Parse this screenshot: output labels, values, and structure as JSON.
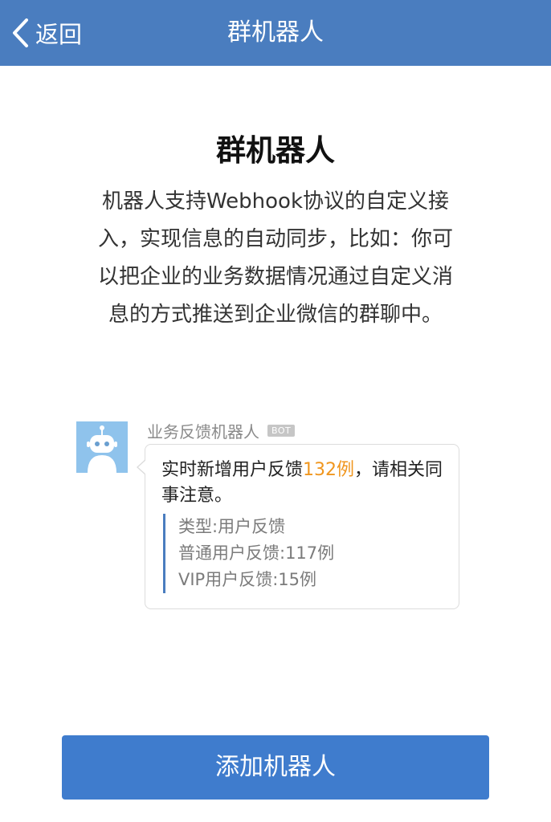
{
  "navbar": {
    "back_label": "返回",
    "title": "群机器人",
    "background": "#4a7dbf"
  },
  "intro": {
    "title": "群机器人",
    "description_lines": [
      "机器人支持Webhook协议的自定义接",
      "入，实现信息的自动同步，比如：你可",
      "以把企业的业务数据情况通过自定义消",
      "息的方式推送到企业微信的群聊中。"
    ]
  },
  "example_message": {
    "avatar_icon": "robot-icon",
    "sender_name": "业务反馈机器人",
    "badge": "BOT",
    "text_before": "实时新增用户反馈",
    "highlight": "132例",
    "text_after": "，请相关同事注意。",
    "highlight_color": "#f0961e",
    "quote_lines": [
      "类型:用户反馈",
      "普通用户反馈:117例",
      "VIP用户反馈:15例"
    ]
  },
  "action": {
    "add_button_label": "添加机器人",
    "color": "#3f7ccd"
  }
}
